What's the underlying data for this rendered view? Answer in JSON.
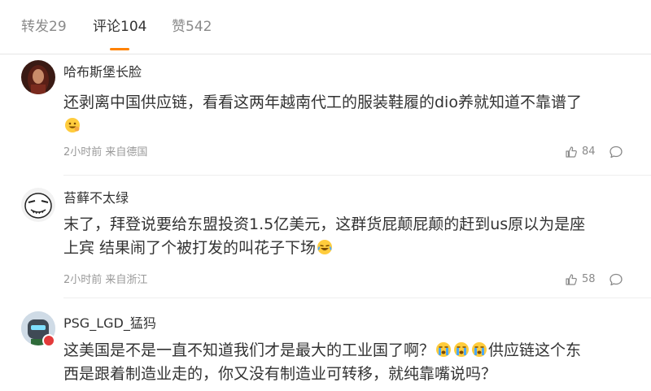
{
  "tabs": [
    {
      "label": "转发29",
      "active": false
    },
    {
      "label": "评论104",
      "active": true
    },
    {
      "label": "赞542",
      "active": false
    }
  ],
  "accent_color": "#ff8200",
  "comments": [
    {
      "user": "哈布斯堡长脸",
      "text": "还剥离中国供应链，看看这两年越南代工的服装鞋履的dio养就知道不靠谱了",
      "emoji_icons": [
        "grin-face-emoji"
      ],
      "meta": "2小时前 来自德国",
      "likes": "84"
    },
    {
      "user": "苔藓不太绿",
      "text_line1": "末了，拜登说要给东盟投资1.5亿美元，这群货屁颠屁颠的赶到us原以为是座",
      "text_line2": "上宾 结果闹了个被打发的叫花子下场",
      "emoji_icons": [
        "laugh-cry-emoji"
      ],
      "meta": "2小时前 来自浙江",
      "likes": "58"
    },
    {
      "user": "PSG_LGD_猛犸",
      "text_part1": "这美国是不是一直不知道我们才是最大的工业国了啊？",
      "text_part2": "供应链这个东",
      "text_line2": "西是跟着制造业走的，你又没有制造业可转移，就纯靠嘴说吗？",
      "emoji_icons": [
        "crying-face-emoji",
        "crying-face-emoji",
        "crying-face-emoji"
      ]
    }
  ]
}
